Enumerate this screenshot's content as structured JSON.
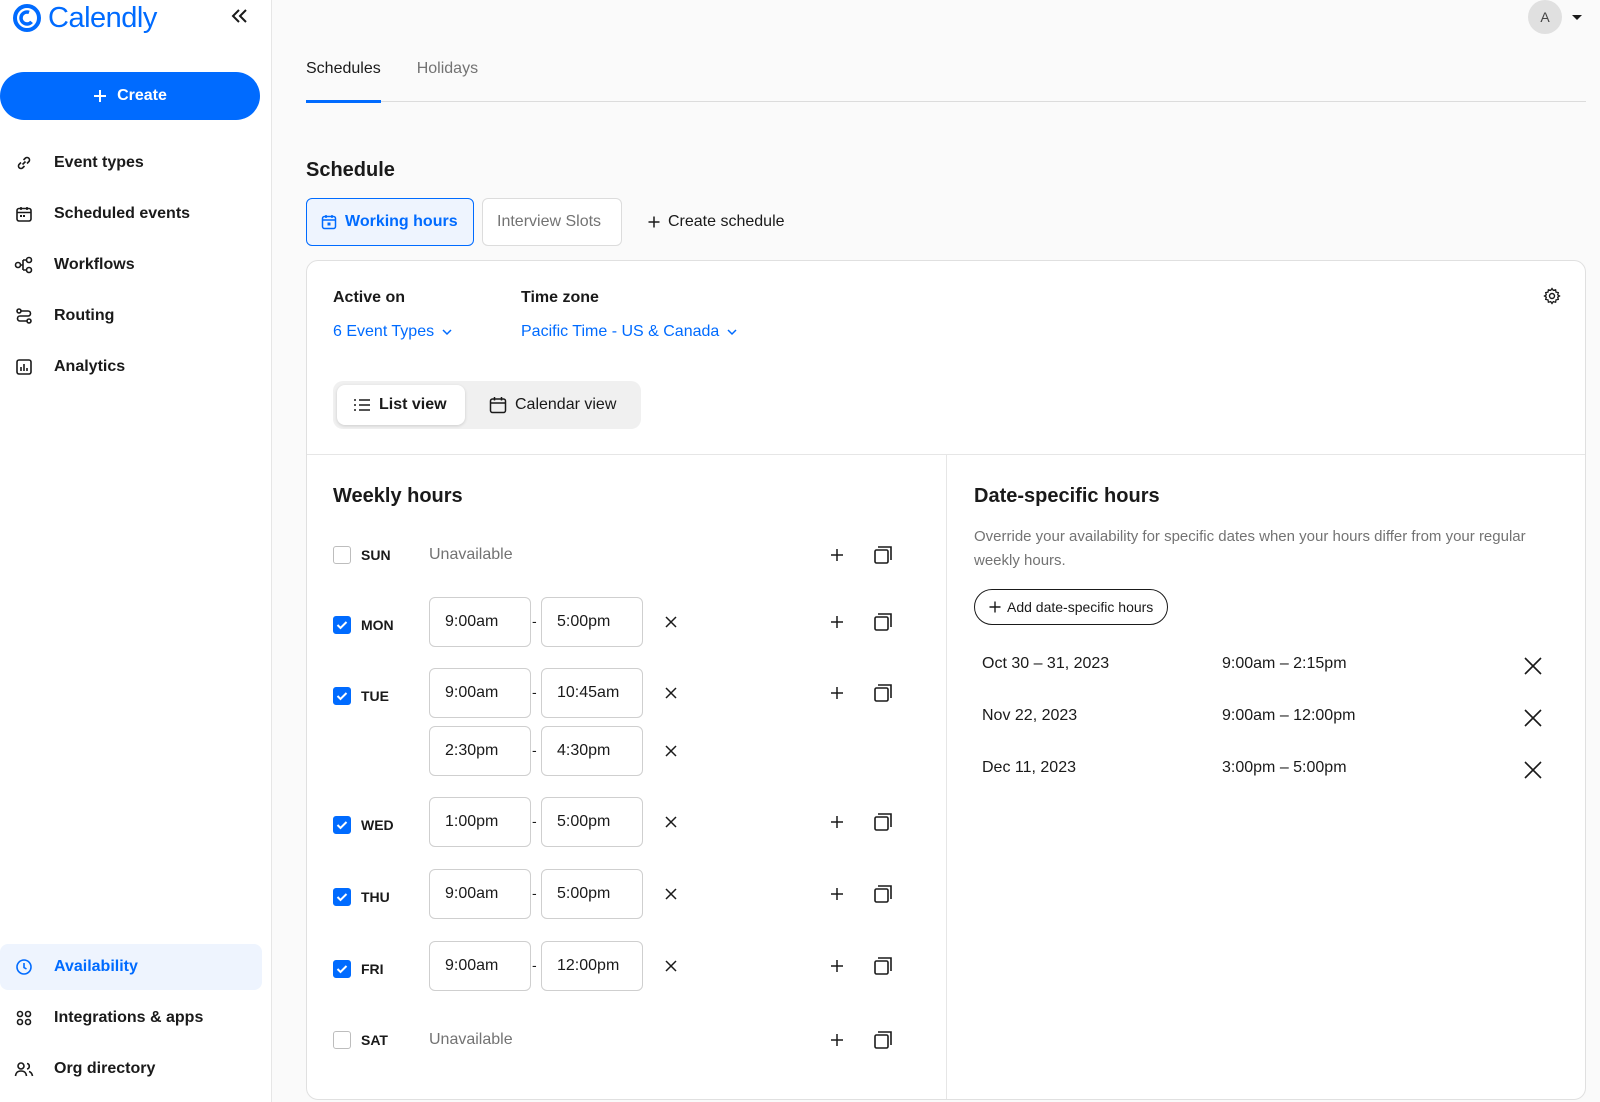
{
  "brand": {
    "name": "Calendly",
    "color": "#006bff"
  },
  "sidebar": {
    "create_label": "Create",
    "items": [
      {
        "label": "Event types",
        "icon": "link-icon"
      },
      {
        "label": "Scheduled events",
        "icon": "calendar-icon"
      },
      {
        "label": "Workflows",
        "icon": "workflow-icon"
      },
      {
        "label": "Routing",
        "icon": "routing-icon"
      },
      {
        "label": "Analytics",
        "icon": "analytics-icon"
      }
    ],
    "bottom_items": [
      {
        "label": "Availability",
        "icon": "clock-icon",
        "active": true
      },
      {
        "label": "Integrations & apps",
        "icon": "grid-icon"
      },
      {
        "label": "Org directory",
        "icon": "people-icon"
      }
    ]
  },
  "header": {
    "avatar_initial": "A"
  },
  "tabs": [
    {
      "label": "Schedules",
      "active": true
    },
    {
      "label": "Holidays",
      "active": false
    }
  ],
  "schedule": {
    "title": "Schedule",
    "buttons": [
      "Working hours",
      "Interview Slots"
    ],
    "create_label": "Create schedule",
    "active_on_label": "Active on",
    "active_on_value": "6 Event Types",
    "timezone_label": "Time zone",
    "timezone_value": "Pacific Time - US & Canada",
    "views": [
      "List view",
      "Calendar view"
    ]
  },
  "weekly": {
    "title": "Weekly hours",
    "unavailable": "Unavailable",
    "days": [
      {
        "day": "SUN",
        "checked": false,
        "slots": []
      },
      {
        "day": "MON",
        "checked": true,
        "slots": [
          [
            "9:00am",
            "5:00pm"
          ]
        ]
      },
      {
        "day": "TUE",
        "checked": true,
        "slots": [
          [
            "9:00am",
            "10:45am"
          ],
          [
            "2:30pm",
            "4:30pm"
          ]
        ]
      },
      {
        "day": "WED",
        "checked": true,
        "slots": [
          [
            "1:00pm",
            "5:00pm"
          ]
        ]
      },
      {
        "day": "THU",
        "checked": true,
        "slots": [
          [
            "9:00am",
            "5:00pm"
          ]
        ]
      },
      {
        "day": "FRI",
        "checked": true,
        "slots": [
          [
            "9:00am",
            "12:00pm"
          ]
        ]
      },
      {
        "day": "SAT",
        "checked": false,
        "slots": []
      }
    ]
  },
  "date_specific": {
    "title": "Date-specific hours",
    "description": "Override your availability for specific dates when your hours differ from your regular weekly hours.",
    "add_label": "Add date-specific hours",
    "entries": [
      {
        "date": "Oct 30 – 31, 2023",
        "range": "9:00am – 2:15pm"
      },
      {
        "date": "Nov 22, 2023",
        "range": "9:00am – 12:00pm"
      },
      {
        "date": "Dec 11, 2023",
        "range": "3:00pm – 5:00pm"
      }
    ]
  }
}
